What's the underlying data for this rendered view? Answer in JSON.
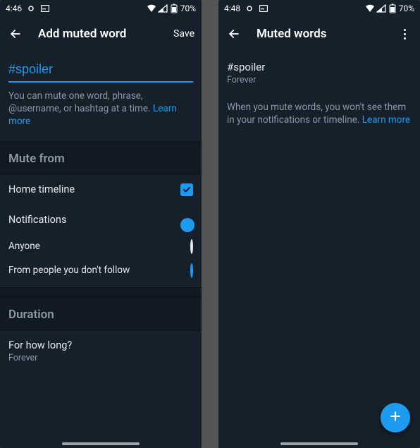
{
  "left": {
    "status": {
      "time": "4:46",
      "battery": "70%"
    },
    "header": {
      "title": "Add muted word",
      "save": "Save"
    },
    "input": {
      "value": "#spoiler"
    },
    "helper": "You can mute one word, phrase, @username, or hashtag at a time. ",
    "learn_more": "Learn more",
    "sections": {
      "mute_from": "Mute from",
      "home_timeline": "Home timeline",
      "notifications": "Notifications",
      "anyone": "Anyone",
      "not_follow": "From people you don't follow",
      "duration": "Duration",
      "how_long": "For how long?",
      "how_long_value": "Forever"
    }
  },
  "right": {
    "status": {
      "time": "4:48",
      "battery": "70%"
    },
    "header": {
      "title": "Muted words"
    },
    "item": {
      "word": "#spoiler",
      "duration": "Forever"
    },
    "desc": "When you mute words, you won't see them in your notifications or timeline. ",
    "learn_more": "Learn more"
  }
}
